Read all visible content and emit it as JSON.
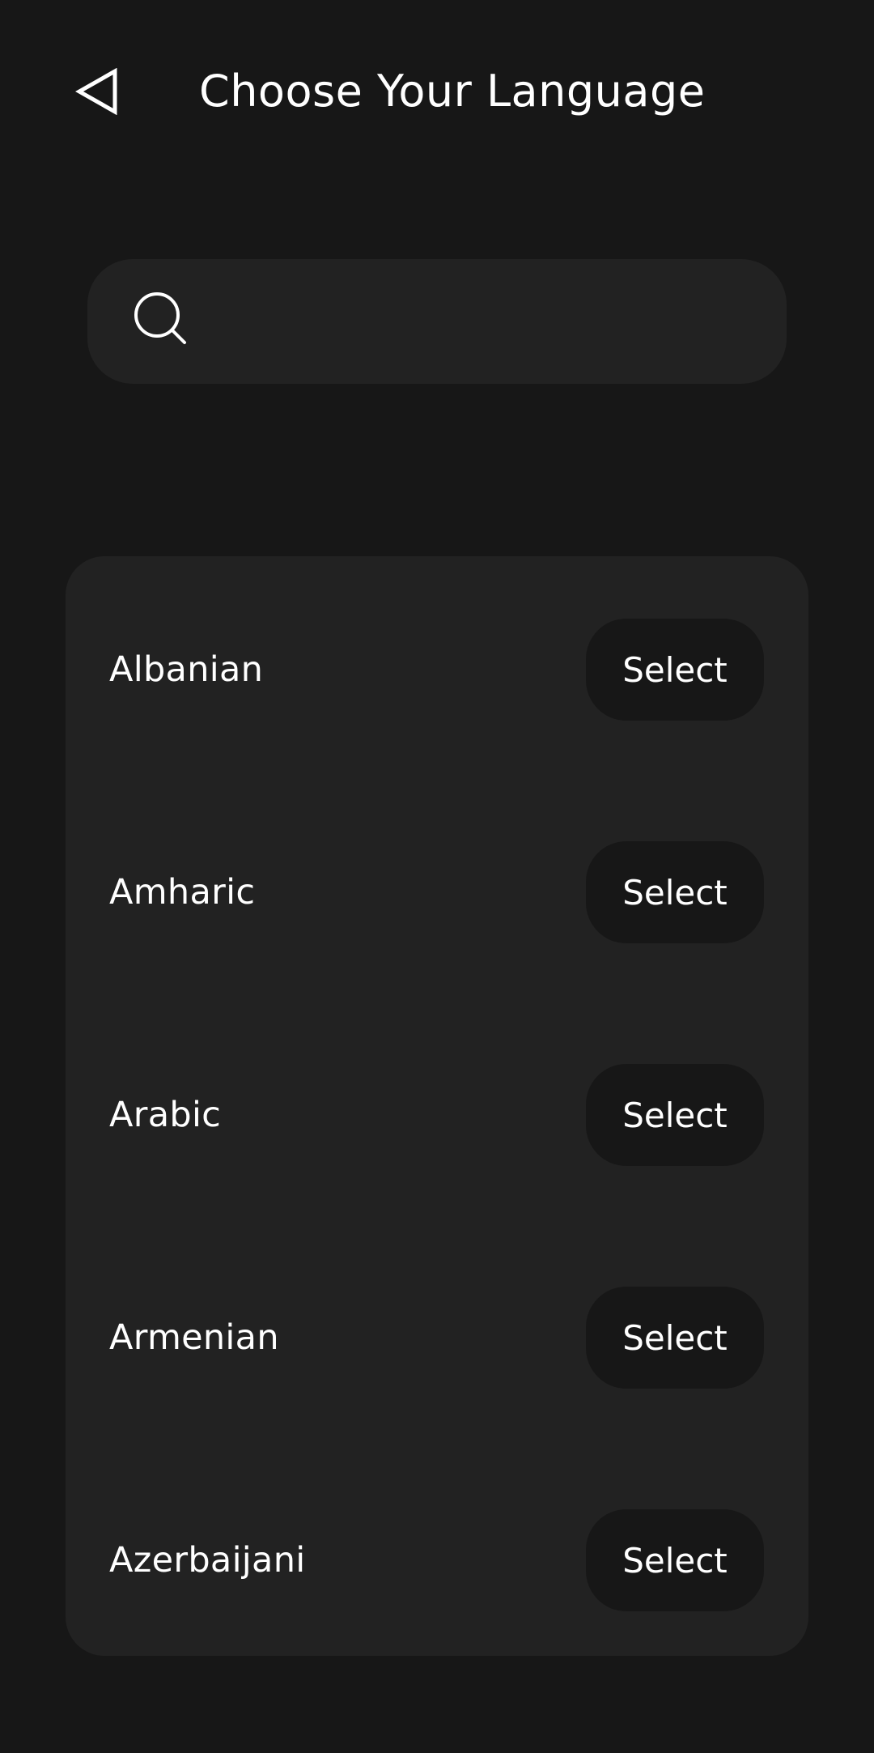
{
  "header": {
    "back_icon": "back-triangle-icon",
    "title": "Choose Your Language"
  },
  "search": {
    "icon": "search-icon",
    "value": "",
    "placeholder": ""
  },
  "languages": [
    {
      "label": "Albanian",
      "button": "Select"
    },
    {
      "label": "Amharic",
      "button": "Select"
    },
    {
      "label": "Arabic",
      "button": "Select"
    },
    {
      "label": "Armenian",
      "button": "Select"
    },
    {
      "label": "Azerbaijani",
      "button": "Select"
    }
  ],
  "colors": {
    "background": "#171717",
    "surface": "#222222",
    "text": "#ffffff"
  }
}
